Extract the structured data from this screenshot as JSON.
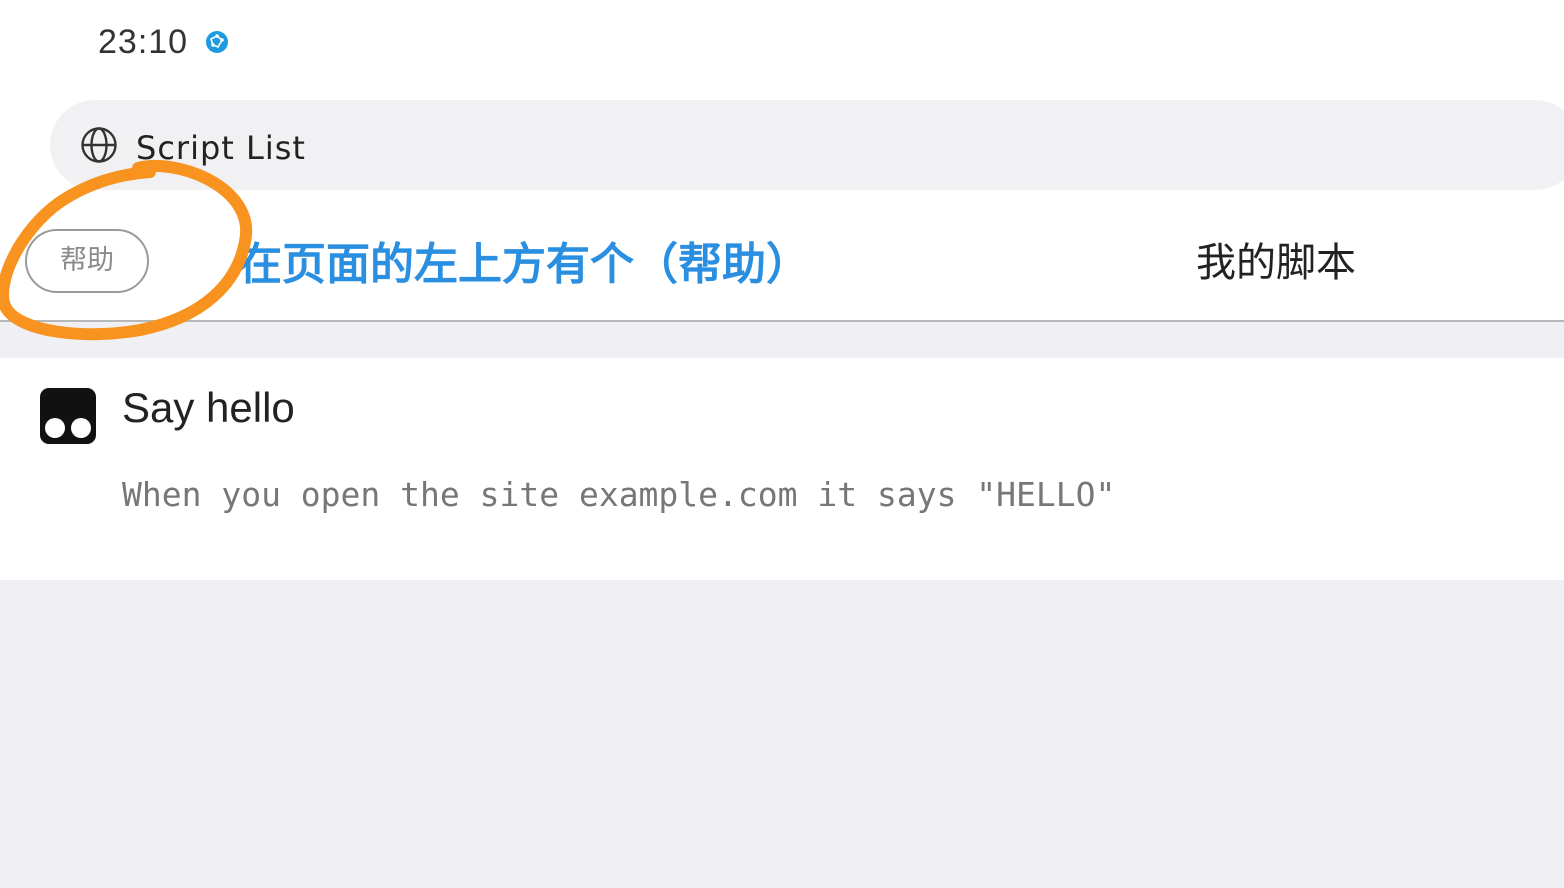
{
  "status_bar": {
    "time": "23:10",
    "indicator_color": "#1e9be0"
  },
  "url_bar": {
    "title": "Script List",
    "icon": "globe-icon"
  },
  "header": {
    "help_label": "帮助",
    "annotation": "在页面的左上方有个（帮助）",
    "title": "我的脚本"
  },
  "scripts": [
    {
      "name": "Say hello",
      "description": "When you open the site example.com it says \"HELLO\"",
      "icon": "tampermonkey-icon"
    }
  ],
  "colors": {
    "annotation_blue": "#2a8fe0",
    "annotation_orange": "#f7931e",
    "background": "#f0f0f4"
  }
}
